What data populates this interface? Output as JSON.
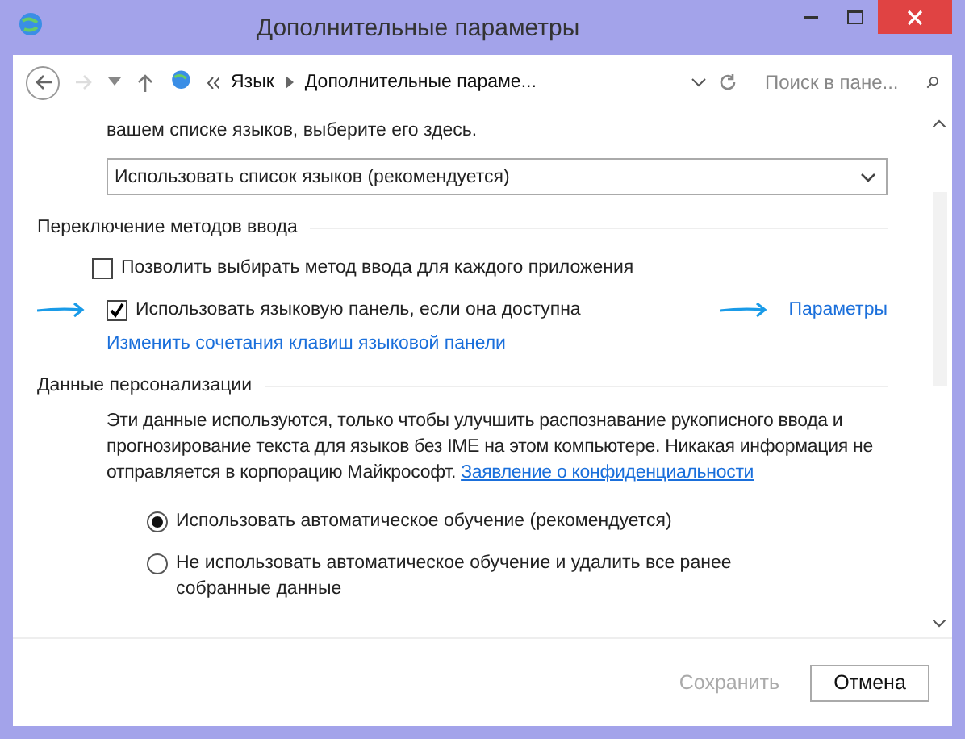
{
  "window": {
    "title": "Дополнительные параметры"
  },
  "address_bar": {
    "breadcrumbs": [
      "Язык",
      "Дополнительные параме..."
    ],
    "search": {
      "placeholder": "Поиск в пане..."
    }
  },
  "intro_text": "вашем списке языков, выберите его здесь.",
  "dropdown": {
    "value": "Использовать список языков (рекомендуется)"
  },
  "input_switching": {
    "heading": "Переключение методов ввода",
    "options": [
      {
        "label": "Позволить выбирать метод ввода для каждого приложения",
        "checked": false
      },
      {
        "label": "Использовать языковую панель, если она доступна",
        "checked": true,
        "link": "Параметры"
      }
    ],
    "link": "Изменить сочетания клавиш языковой панели"
  },
  "personalization": {
    "heading": "Данные персонализации",
    "description": "Эти данные используются, только чтобы улучшить распознавание рукописного ввода и прогнозирование текста для языков без IME на этом компьютере. Никакая информация не отправляется в корпорацию Майкрософт.",
    "privacy_link": "Заявление о конфиденциальности",
    "options": [
      {
        "label": "Использовать автоматическое обучение (рекомендуется)",
        "selected": true
      },
      {
        "label": "Не использовать автоматическое обучение и удалить все ранее собранные данные",
        "selected": false
      }
    ]
  },
  "buttons": [
    {
      "label": "Сохранить",
      "disabled": true
    },
    {
      "label": "Отмена",
      "disabled": false
    }
  ]
}
